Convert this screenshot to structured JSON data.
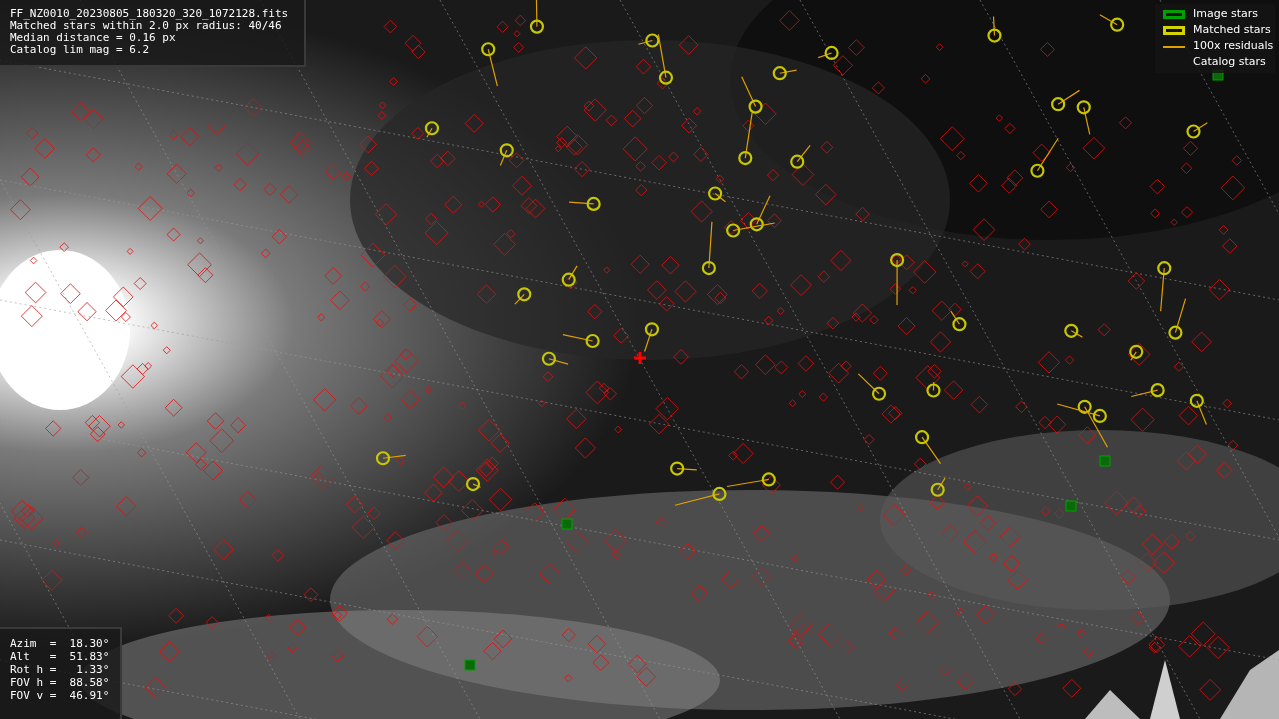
{
  "info": {
    "lines": [
      "FF_NZ0010_20230805_180320_320_1072128.fits",
      "Matched stars within 2.0 px radius: 40/46",
      "Median distance = 0.16 px",
      "Catalog lim mag = 6.2"
    ]
  },
  "legend": [
    {
      "kind": "box",
      "color": "#00a000",
      "label": "Image stars"
    },
    {
      "kind": "box",
      "color": "#d4d400",
      "label": "Matched stars"
    },
    {
      "kind": "line",
      "color": "#e0a000",
      "label": "100x residuals"
    },
    {
      "kind": "none",
      "label": "Catalog stars"
    }
  ],
  "pointing": [
    {
      "text": "Azim  =  18.30°"
    },
    {
      "text": "Alt   =  51.83°"
    },
    {
      "text": "Rot h =   1.33°"
    },
    {
      "text": "FOV h =  88.58°"
    },
    {
      "text": "FOV v =  46.91°"
    }
  ]
}
